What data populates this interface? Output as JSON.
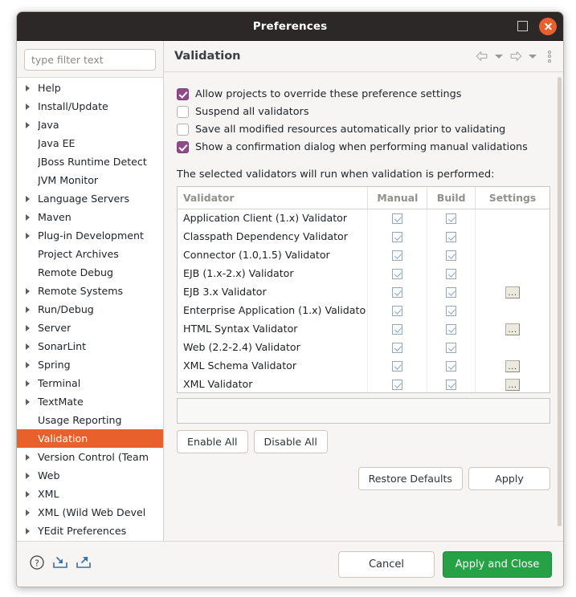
{
  "window": {
    "title": "Preferences",
    "controls": {
      "maximize_icon": "maximize-icon",
      "close_icon": "close-icon"
    }
  },
  "sidebar": {
    "filter": {
      "value": "",
      "placeholder": "type filter text"
    },
    "items": [
      {
        "label": "Help",
        "expandable": true,
        "selected": false
      },
      {
        "label": "Install/Update",
        "expandable": true,
        "selected": false
      },
      {
        "label": "Java",
        "expandable": true,
        "selected": false
      },
      {
        "label": "Java EE",
        "expandable": false,
        "selected": false
      },
      {
        "label": "JBoss Runtime Detect",
        "expandable": false,
        "selected": false
      },
      {
        "label": "JVM Monitor",
        "expandable": false,
        "selected": false
      },
      {
        "label": "Language Servers",
        "expandable": true,
        "selected": false
      },
      {
        "label": "Maven",
        "expandable": true,
        "selected": false
      },
      {
        "label": "Plug-in Development",
        "expandable": true,
        "selected": false
      },
      {
        "label": "Project Archives",
        "expandable": false,
        "selected": false
      },
      {
        "label": "Remote Debug",
        "expandable": false,
        "selected": false
      },
      {
        "label": "Remote Systems",
        "expandable": true,
        "selected": false
      },
      {
        "label": "Run/Debug",
        "expandable": true,
        "selected": false
      },
      {
        "label": "Server",
        "expandable": true,
        "selected": false
      },
      {
        "label": "SonarLint",
        "expandable": true,
        "selected": false
      },
      {
        "label": "Spring",
        "expandable": true,
        "selected": false
      },
      {
        "label": "Terminal",
        "expandable": true,
        "selected": false
      },
      {
        "label": "TextMate",
        "expandable": true,
        "selected": false
      },
      {
        "label": "Usage Reporting",
        "expandable": false,
        "selected": false
      },
      {
        "label": "Validation",
        "expandable": false,
        "selected": true
      },
      {
        "label": "Version Control (Team",
        "expandable": true,
        "selected": false
      },
      {
        "label": "Web",
        "expandable": true,
        "selected": false
      },
      {
        "label": "XML",
        "expandable": true,
        "selected": false
      },
      {
        "label": "XML (Wild Web Devel",
        "expandable": true,
        "selected": false
      },
      {
        "label": "YEdit Preferences",
        "expandable": true,
        "selected": false
      }
    ]
  },
  "page": {
    "title": "Validation",
    "toolbar": {
      "back_icon": "back-arrow-icon",
      "back_menu_icon": "chevron-down-icon",
      "forward_icon": "forward-arrow-icon",
      "forward_menu_icon": "chevron-down-icon",
      "menu_icon": "kebab-menu-icon"
    },
    "options": [
      {
        "label": "Allow projects to override these preference settings",
        "checked": true
      },
      {
        "label": "Suspend all validators",
        "checked": false
      },
      {
        "label": "Save all modified resources automatically prior to validating",
        "checked": false
      },
      {
        "label": "Show a confirmation dialog when performing manual validations",
        "checked": true
      }
    ],
    "table_note": "The selected validators will run when validation is performed:",
    "table": {
      "columns": [
        "Validator",
        "Manual",
        "Build",
        "Settings"
      ],
      "rows": [
        {
          "validator": "Application Client (1.x) Validator",
          "manual": true,
          "build": true,
          "settings": false
        },
        {
          "validator": "Classpath Dependency Validator",
          "manual": true,
          "build": true,
          "settings": false
        },
        {
          "validator": "Connector (1.0,1.5) Validator",
          "manual": true,
          "build": true,
          "settings": false
        },
        {
          "validator": "EJB (1.x-2.x) Validator",
          "manual": true,
          "build": true,
          "settings": false
        },
        {
          "validator": "EJB 3.x Validator",
          "manual": true,
          "build": true,
          "settings": true
        },
        {
          "validator": "Enterprise Application (1.x) Validato",
          "manual": true,
          "build": true,
          "settings": false
        },
        {
          "validator": "HTML Syntax Validator",
          "manual": true,
          "build": true,
          "settings": true
        },
        {
          "validator": "Web (2.2-2.4) Validator",
          "manual": true,
          "build": true,
          "settings": false
        },
        {
          "validator": "XML Schema Validator",
          "manual": true,
          "build": true,
          "settings": true
        },
        {
          "validator": "XML Validator",
          "manual": true,
          "build": true,
          "settings": true
        }
      ],
      "settings_button_label": "..."
    },
    "status_text": "",
    "buttons": {
      "enable_all": "Enable All",
      "disable_all": "Disable All",
      "restore_defaults": "Restore Defaults",
      "apply": "Apply"
    }
  },
  "footer": {
    "icons": [
      {
        "name": "help-icon"
      },
      {
        "name": "import-icon"
      },
      {
        "name": "export-icon"
      }
    ],
    "cancel_label": "Cancel",
    "apply_close_label": "Apply and Close"
  },
  "colors": {
    "titlebar": "#2b2827",
    "selection": "#e8602c",
    "close_button": "#e8602c",
    "checkbox_checked": "#8f4a89",
    "apply_close": "#26a146",
    "panel": "#f6f5f4"
  }
}
